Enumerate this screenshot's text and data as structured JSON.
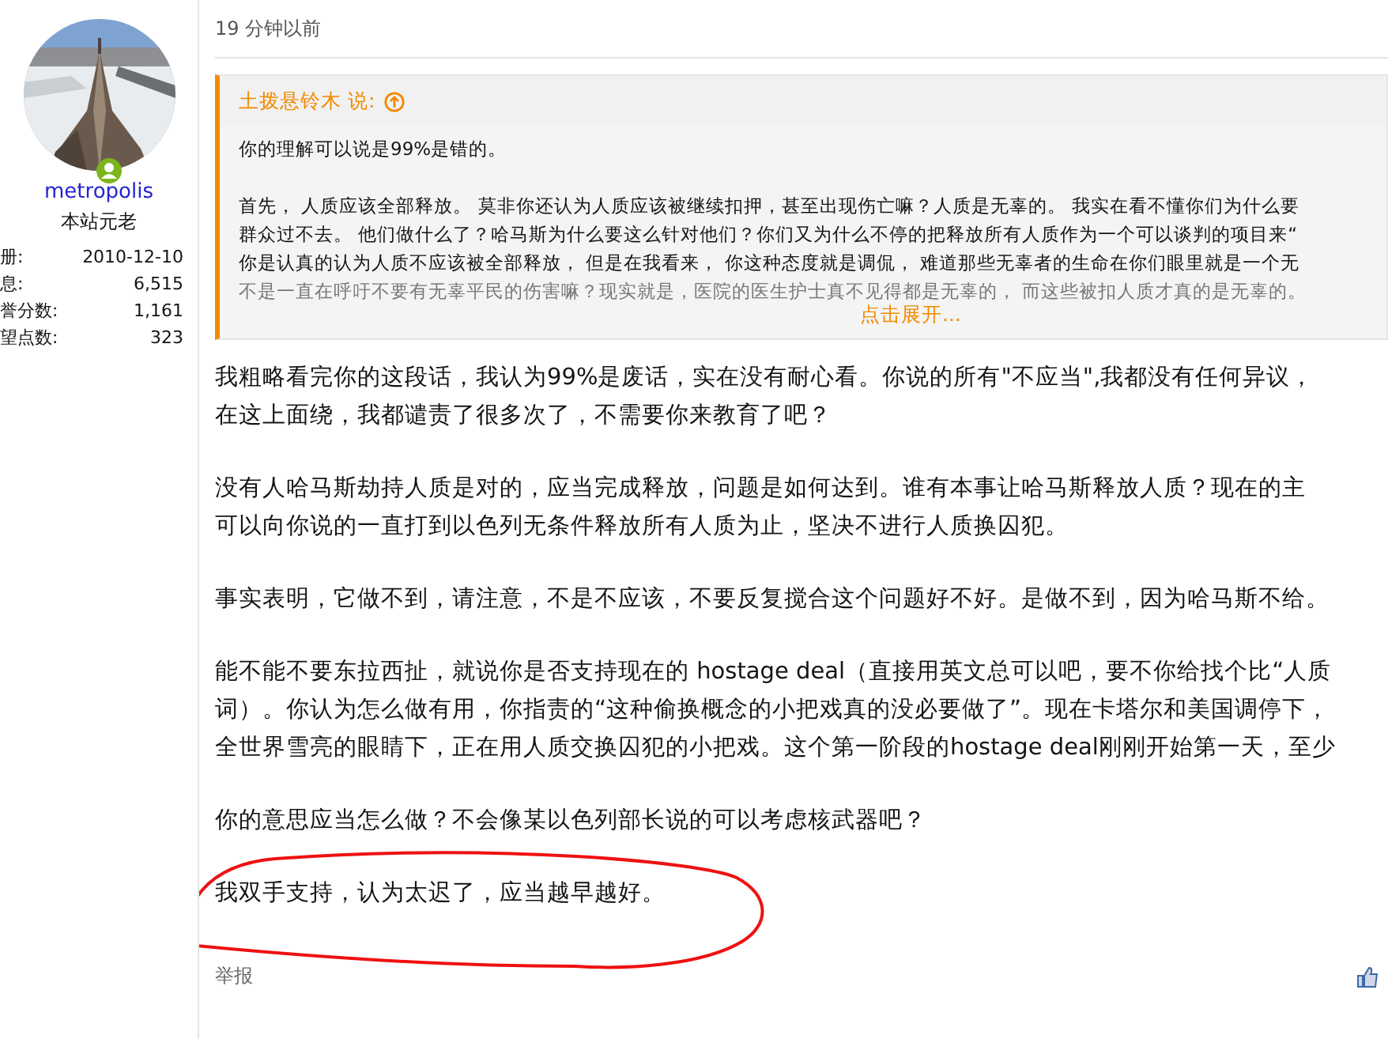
{
  "sidebar": {
    "avatar": {
      "kind": "picture",
      "online": true
    },
    "username": "metropolis",
    "user_title": "本站元老",
    "stats": [
      {
        "label": "册:",
        "value": "2010-12-10"
      },
      {
        "label": "息:",
        "value": "6,515"
      },
      {
        "label": "誉分数:",
        "value": "1,161"
      },
      {
        "label": "望点数:",
        "value": "323"
      }
    ]
  },
  "post": {
    "time": "19 分钟以前",
    "quote": {
      "author": "土拨悬铃木 说:",
      "paragraphs": [
        [
          "你的理解可以说是99%是错的。"
        ],
        [
          "首先， 人质应该全部释放。 莫非你还认为人质应该被继续扣押，甚至出现伤亡嘛？人质是无辜的。 我实在看不懂你们为什么要",
          "群众过不去。 他们做什么了？哈马斯为什么要这么针对他们？你们又为什么不停的把释放所有人质作为一个可以谈判的项目来“",
          "你是认真的认为人质不应该被全部释放， 但是在我看来， 你这种态度就是调侃， 难道那些无辜者的生命在你们眼里就是一个无",
          "不是一直在呼吁不要有无辜平民的伤害嘛？现实就是，医院的医生护士真不见得都是无辜的， 而这些被扣人质才真的是无辜的。"
        ]
      ],
      "expand_link": "点击展开..."
    },
    "body": [
      {
        "lines": [
          "我粗略看完你的这段话，我认为99%是废话，实在没有耐心看。你说的所有\"不应当\",我都没有任何异议，",
          "在这上面绕，我都谴责了很多次了，不需要你来教育了吧？"
        ],
        "circled": false
      },
      {
        "lines": [
          "没有人哈马斯劫持人质是对的，应当完成释放，问题是如何达到。谁有本事让哈马斯释放人质？现在的主",
          "可以向你说的一直打到以色列无条件释放所有人质为止，坚决不进行人质换囚犯。"
        ],
        "circled": false
      },
      {
        "lines": [
          "事实表明，它做不到，请注意，不是不应该，不要反复搅合这个问题好不好。是做不到，因为哈马斯不给。"
        ],
        "circled": false
      },
      {
        "lines": [
          "能不能不要东拉西扯，就说你是否支持现在的 hostage deal（直接用英文总可以吧，要不你给找个比“人质",
          "词）。你认为怎么做有用，你指责的“这种偷换概念的小把戏真的没必要做了”。现在卡塔尔和美国调停下，",
          "全世界雪亮的眼睛下，正在用人质交换囚犯的小把戏。这个第一阶段的hostage deal刚刚开始第一天，至少"
        ],
        "circled": false
      },
      {
        "lines": [
          "你的意思应当怎么做？不会像某以色列部长说的可以考虑核武器吧？"
        ],
        "circled": false
      },
      {
        "lines": [
          "我双手支持，认为太迟了，应当越早越好。"
        ],
        "circled": true
      }
    ],
    "report_link": "举报"
  }
}
